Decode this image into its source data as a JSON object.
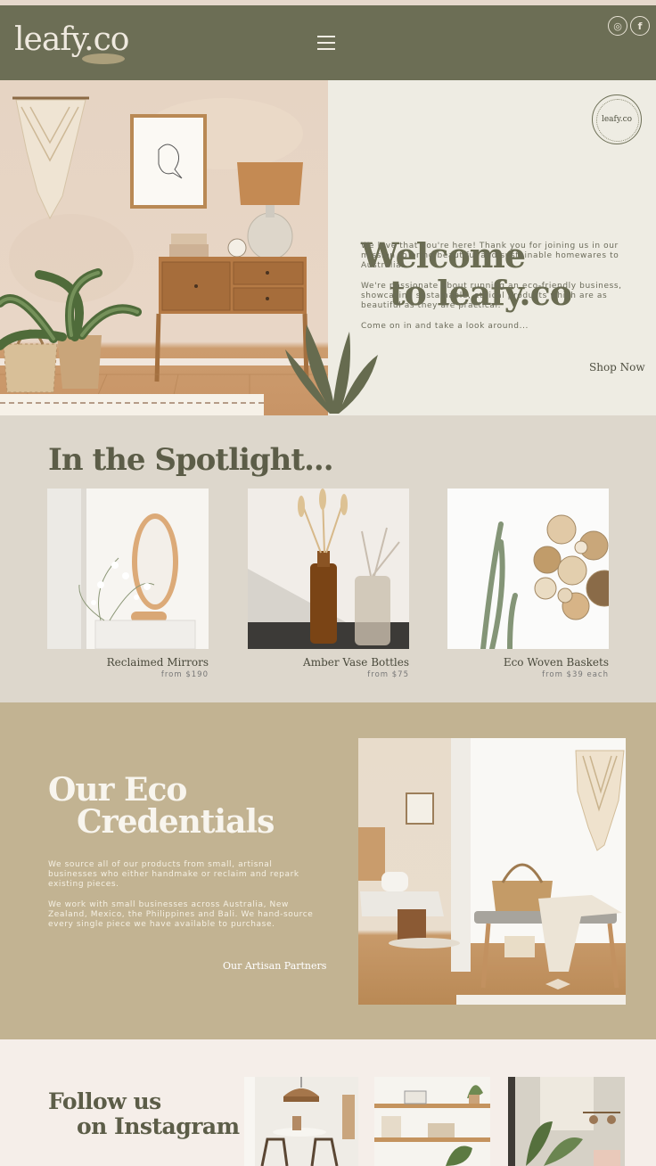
{
  "header": {
    "logo": "leafy.co",
    "menu_icon": "hamburger-menu-icon",
    "social": [
      {
        "icon": "instagram-icon",
        "glyph": "◎"
      },
      {
        "icon": "facebook-icon",
        "glyph": "f"
      }
    ]
  },
  "hero": {
    "badge": "leafy.co",
    "title_line1": "Welcome",
    "title_line2": "to leafy.co",
    "paragraphs": [
      "We love that you're here! Thank you for joining us in our mission to bring beautiful and sustainable homewares to Australia!",
      "We're passionate about running an eco-friendly business, showcasing sustainable, ethical products which are as beautiful as they are practical.",
      "Come on in and take a look around..."
    ],
    "cta": "Shop Now"
  },
  "spotlight": {
    "title": "In the Spotlight...",
    "products": [
      {
        "name": "Reclaimed Mirrors",
        "price": "from $190"
      },
      {
        "name": "Amber Vase Bottles",
        "price": "from $75"
      },
      {
        "name": "Eco Woven Baskets",
        "price": "from $39 each"
      }
    ]
  },
  "eco": {
    "title_line1": "Our Eco",
    "title_line2": "Credentials",
    "paragraphs": [
      "We source all of our products from small, artisnal businesses who either handmake or reclaim and repark existing pieces.",
      "We work with small businesses across Australia, New Zealand, Mexico, the Philippines and Bali. We hand-source every single  piece we have available to purchase."
    ],
    "cta": "Our Artisan Partners"
  },
  "instagram": {
    "title_line1": "Follow us",
    "title_line2": "on Instagram"
  },
  "colors": {
    "header_green": "#6c6e55",
    "hero_bg": "#eeece3",
    "spotlight_bg": "#ddd7cc",
    "eco_bg": "#c2b392",
    "insta_bg": "#f5eee9"
  }
}
